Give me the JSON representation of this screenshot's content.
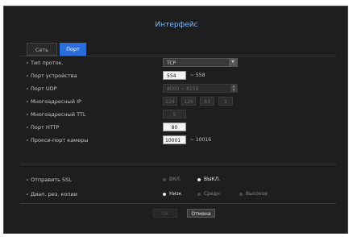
{
  "title": "Интерфейс",
  "tabs": [
    {
      "label": "Сеть",
      "active": false
    },
    {
      "label": "Порт",
      "active": true
    }
  ],
  "fields": {
    "protocol": {
      "label": "Тип проток.",
      "value": "TCP"
    },
    "device_port": {
      "label": "Порт устройства",
      "value": "554",
      "range": "~ 558"
    },
    "udp_port": {
      "label": "Порт UDP",
      "value": "8000 ~ 8159"
    },
    "multicast_ip": {
      "label": "Многоадресный IP",
      "octets": [
        "224",
        "126",
        "63",
        "1"
      ]
    },
    "multicast_ttl": {
      "label": "Многоадресный TTL",
      "value": "5"
    },
    "http_port": {
      "label": "Порт HTTP",
      "value": "80"
    },
    "camera_proxy": {
      "label": "Прокси-порт камеры",
      "value": "10001",
      "range": "~ 10016"
    }
  },
  "ssl": {
    "label": "Отправить SSL",
    "options": [
      {
        "label": "ВКЛ.",
        "checked": false
      },
      {
        "label": "ВЫКЛ.",
        "checked": true
      }
    ]
  },
  "copy_range": {
    "label": "Диап. рез. копии",
    "options": [
      {
        "label": "Низк",
        "checked": true
      },
      {
        "label": "Средн.",
        "checked": false
      },
      {
        "label": "Высокое",
        "checked": false
      }
    ]
  },
  "buttons": {
    "ok": "OK",
    "cancel": "Отмена"
  },
  "colors": {
    "accent": "#2b6edb",
    "title": "#7ab8ff",
    "background": "#1e1e1e"
  },
  "icons": {
    "dropdown": "chevron-down-icon",
    "spinner": "spinner-arrows-icon"
  }
}
